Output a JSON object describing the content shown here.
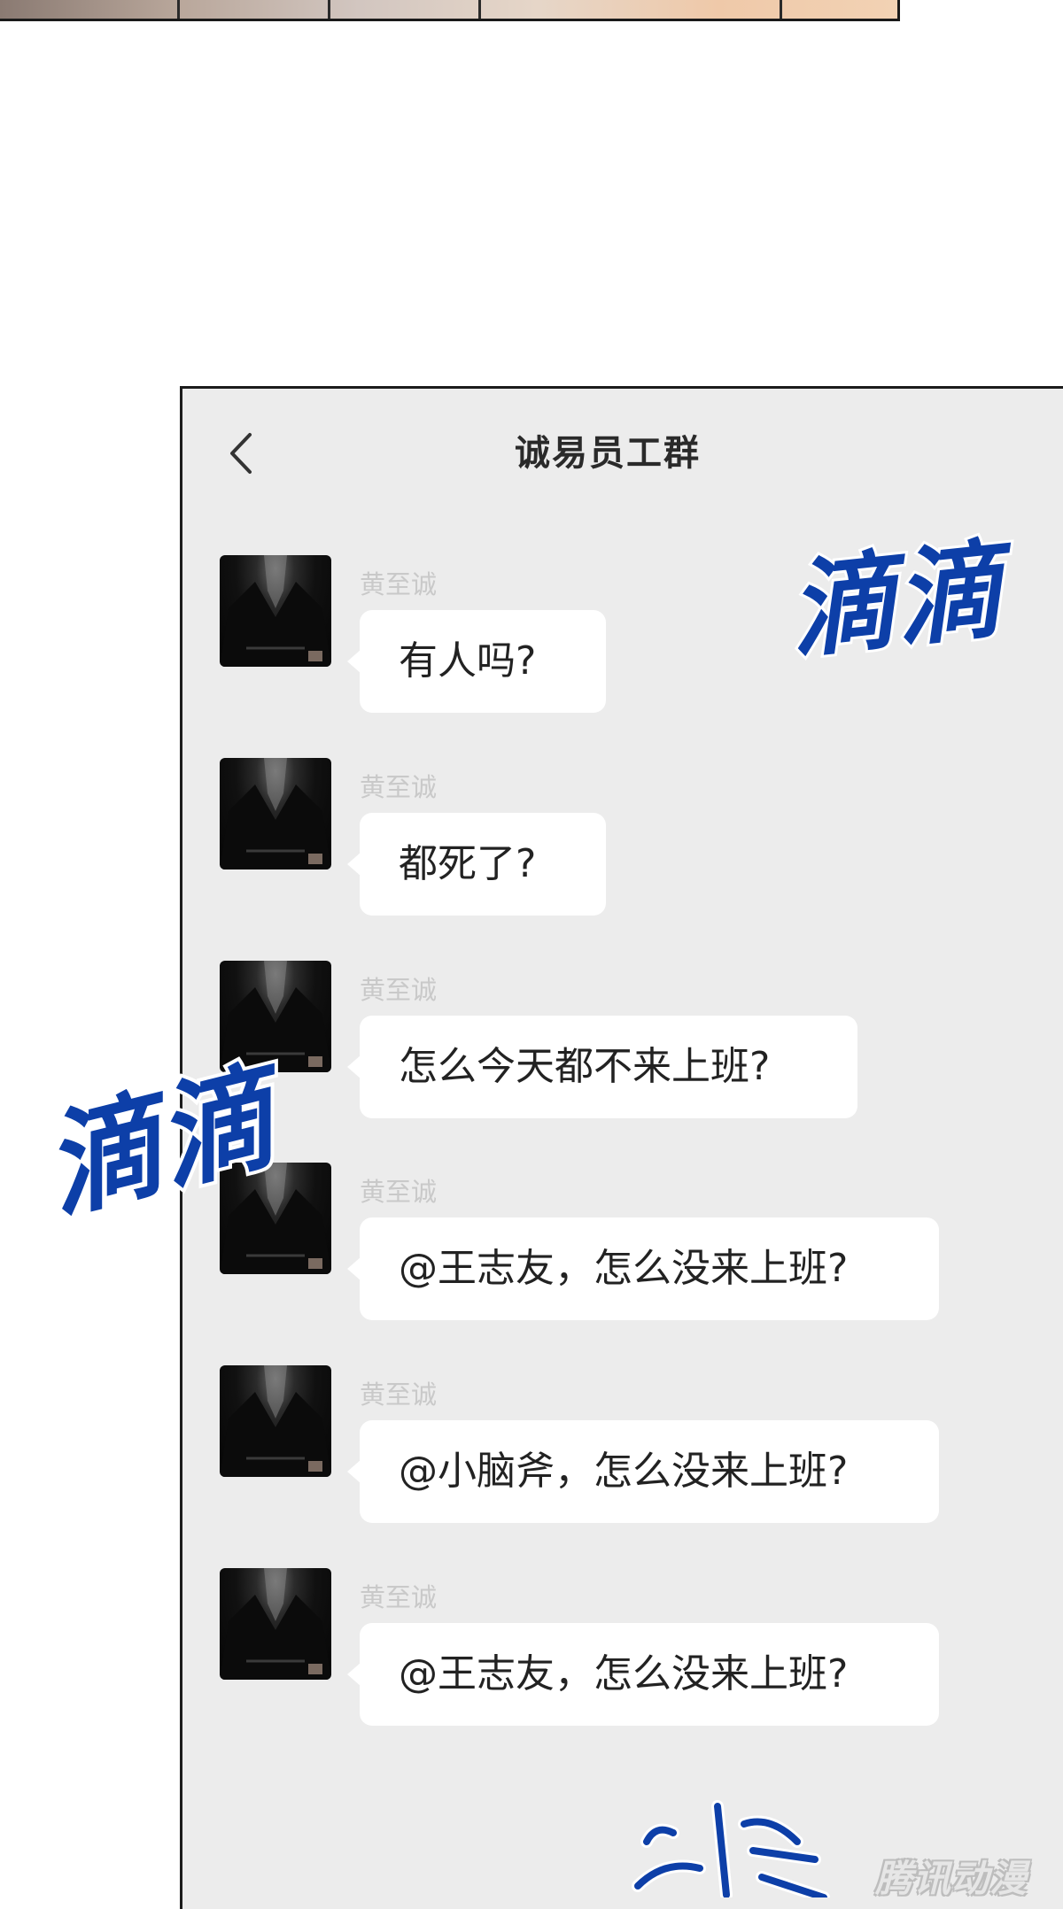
{
  "chat": {
    "title": "诚易员工群",
    "messages": [
      {
        "sender": "黄至诚",
        "text": "有人吗?"
      },
      {
        "sender": "黄至诚",
        "text": "都死了?"
      },
      {
        "sender": "黄至诚",
        "text": "怎么今天都不来上班?"
      },
      {
        "sender": "黄至诚",
        "text": "@王志友，怎么没来上班?"
      },
      {
        "sender": "黄至诚",
        "text": "@小脑斧，怎么没来上班?"
      },
      {
        "sender": "黄至诚",
        "text": "@王志友，怎么没来上班?"
      }
    ]
  },
  "sound_effects": [
    "滴滴",
    "滴滴"
  ],
  "watermark": "腾讯动漫",
  "colors": {
    "chat_background": "#ececec",
    "bubble": "#ffffff",
    "sfx": "#0d3fa8",
    "sender": "#c9c9c9"
  },
  "icons": {
    "back": "chevron-left-icon",
    "avatar": "profile-photo-black-shirt"
  }
}
